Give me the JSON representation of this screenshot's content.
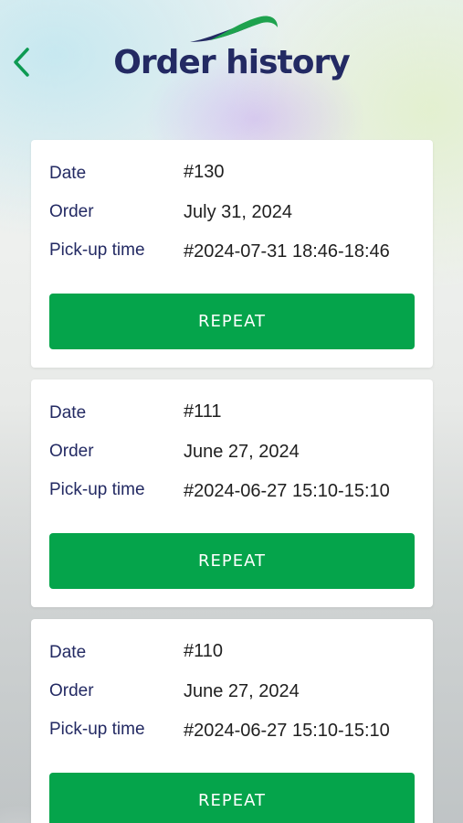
{
  "header": {
    "title": "Order history",
    "back_icon": "chevron-left-icon",
    "logo": "swoosh-logo"
  },
  "colors": {
    "accent_green": "#05a44b",
    "title_navy": "#232a63",
    "back_green": "#0d9a52"
  },
  "labels": {
    "date": "Date",
    "order": "Order",
    "pickup": "Pick-up time",
    "repeat": "REPEAT"
  },
  "orders": [
    {
      "date": "#130",
      "order": "July 31, 2024",
      "pickup": "#2024-07-31 18:46-18:46"
    },
    {
      "date": "#111",
      "order": "June 27, 2024",
      "pickup": "#2024-06-27 15:10-15:10"
    },
    {
      "date": "#110",
      "order": "June 27, 2024",
      "pickup": "#2024-06-27 15:10-15:10"
    }
  ]
}
